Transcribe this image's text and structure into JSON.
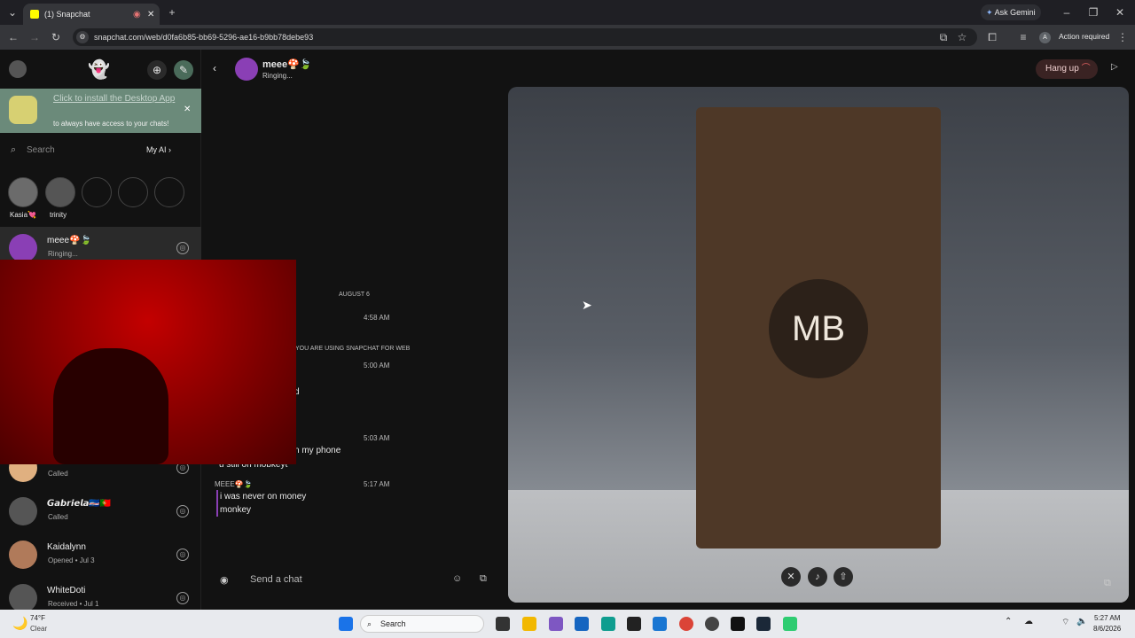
{
  "browser": {
    "tab_title": "(1) Snapchat",
    "url": "snapchat.com/web/d0fa6b85-bb69-5296-ae16-b9bb78debe93",
    "ask_gemini": "Ask Gemini",
    "action_required": "Action required",
    "profile_initial": "A"
  },
  "banner": {
    "link_text": "Click to install the Desktop App",
    "subtext": "to always have access to your chats!"
  },
  "search": {
    "placeholder": "Search",
    "my_ai": "My AI"
  },
  "stories": [
    {
      "label": "Kasia💘"
    },
    {
      "label": "trinity"
    }
  ],
  "chats": [
    {
      "name": "meee🍄🍃",
      "status": "Ringing..."
    },
    {
      "name": "",
      "status": "Called"
    },
    {
      "name": "𝙂𝙖𝙗𝙧𝙞𝙚𝙡𝙖🇨🇻🇵🇹",
      "status": "Called"
    },
    {
      "name": "Kaidalynn",
      "status": "Opened • Jul 3"
    },
    {
      "name": "WhiteDoti",
      "status": "Received • Jul 1"
    }
  ],
  "header": {
    "contact_name": "meee🍄🍃",
    "contact_status": "Ringing...",
    "hangup_label": "Hang up"
  },
  "conversation": {
    "date_divider": "AUGUST 6",
    "times": [
      "4:58 AM",
      "5:00 AM",
      "5:03 AM",
      "5:17 AM"
    ],
    "system_notice": "YOU ARE USING SNAPCHAT FOR WEB",
    "partial_1": "d",
    "partial_2": "n my phone",
    "partial_3": "u still on mobkeyt",
    "sender": "MEEE🍄🍃",
    "last_message_line1": "i was never on money",
    "last_message_line2": "monkey",
    "composer_placeholder": "Send a chat"
  },
  "call": {
    "initials": "MB"
  },
  "taskbar": {
    "weather_temp": "74°F",
    "weather_cond": "Clear",
    "search_label": "Search",
    "time": "5:27 AM",
    "date": "8/6/2026"
  }
}
